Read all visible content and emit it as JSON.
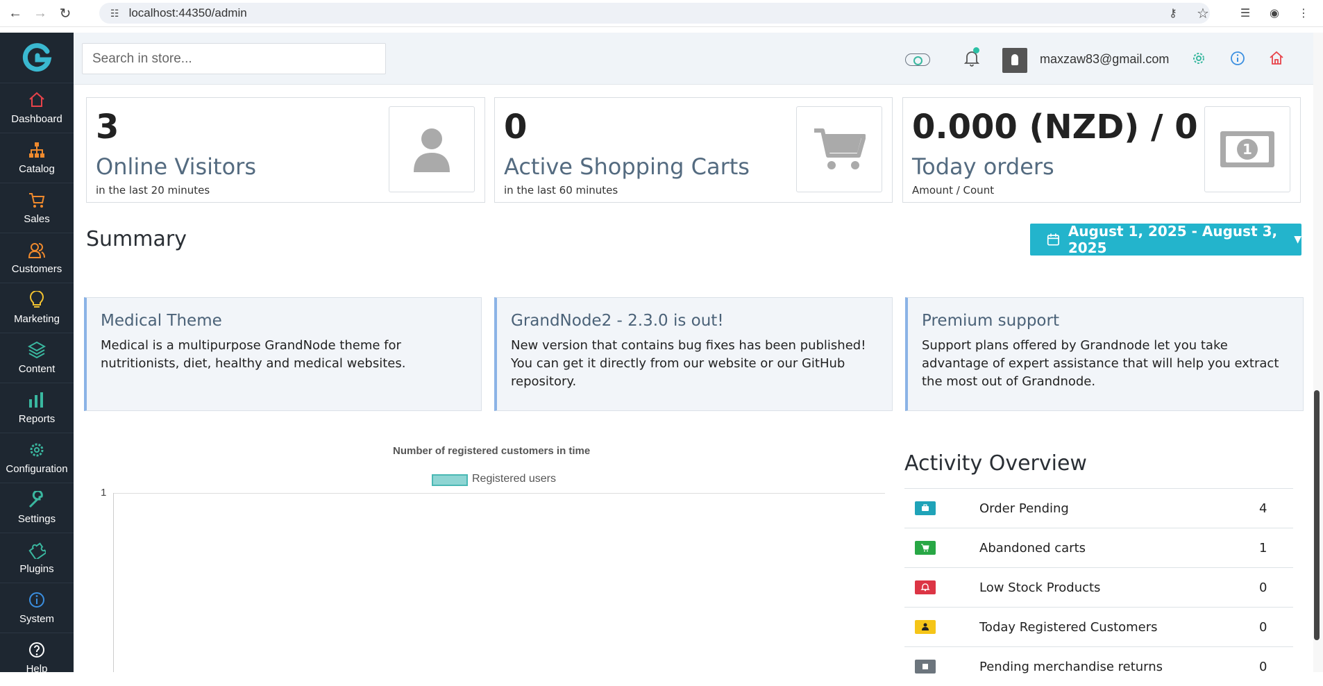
{
  "browser": {
    "url": "localhost:44350/admin"
  },
  "sidebar": {
    "items": [
      {
        "label": "Dashboard",
        "icon": "home-icon",
        "color": "#e8434a"
      },
      {
        "label": "Catalog",
        "icon": "sitemap-icon",
        "color": "#f08a2d"
      },
      {
        "label": "Sales",
        "icon": "cart-icon",
        "color": "#f08a2d"
      },
      {
        "label": "Customers",
        "icon": "users-icon",
        "color": "#f08a2d"
      },
      {
        "label": "Marketing",
        "icon": "bulb-icon",
        "color": "#f2c230"
      },
      {
        "label": "Content",
        "icon": "layers-icon",
        "color": "#3ab8a0"
      },
      {
        "label": "Reports",
        "icon": "bar-chart-icon",
        "color": "#3ab8a0"
      },
      {
        "label": "Configuration",
        "icon": "gear-icon",
        "color": "#3ab8a0"
      },
      {
        "label": "Settings",
        "icon": "wrench-icon",
        "color": "#3ab8a0"
      },
      {
        "label": "Plugins",
        "icon": "puzzle-icon",
        "color": "#3ab8a0"
      },
      {
        "label": "System",
        "icon": "info-icon",
        "color": "#3b8fe0"
      },
      {
        "label": "Help",
        "icon": "question-icon",
        "color": "#ffffff"
      }
    ]
  },
  "header": {
    "search_placeholder": "Search in store...",
    "user_email": "maxzaw83@gmail.com"
  },
  "stats": [
    {
      "value": "3",
      "title": "Online Visitors",
      "sub": "in the last 20 minutes",
      "icon": "user-icon"
    },
    {
      "value": "0",
      "title": "Active Shopping Carts",
      "sub": "in the last 60 minutes",
      "icon": "cart-icon"
    },
    {
      "value": "0.000 (NZD) / 0",
      "title": "Today orders",
      "sub": "Amount / Count",
      "icon": "money-icon"
    }
  ],
  "summary": {
    "title": "Summary",
    "date_range": "August 1, 2025 - August 3, 2025"
  },
  "news": [
    {
      "title": "Medical Theme",
      "body": "Medical is a multipurpose GrandNode theme for nutritionists, diet, healthy and medical websites."
    },
    {
      "title": "GrandNode2 - 2.3.0 is out!",
      "body": "New version that contains bug fixes has been published! You can get it directly from our website or our GitHub repository."
    },
    {
      "title": "Premium support",
      "body": "Support plans offered by Grandnode let you take advantage of expert assistance that will help you extract the most out of Grandnode."
    }
  ],
  "chart_data": {
    "type": "bar",
    "title": "Number of registered customers in time",
    "series": [
      {
        "name": "Registered users",
        "values": []
      }
    ],
    "y_ticks": [
      "1"
    ],
    "ylim": [
      0,
      1
    ],
    "color": "#8ed5d3"
  },
  "activity": {
    "title": "Activity Overview",
    "rows": [
      {
        "label": "Order Pending",
        "count": "4",
        "color": "#1fa3b8",
        "icon": "briefcase-icon"
      },
      {
        "label": "Abandoned carts",
        "count": "1",
        "color": "#28a745",
        "icon": "cart-icon"
      },
      {
        "label": "Low Stock Products",
        "count": "0",
        "color": "#dc3545",
        "icon": "bell-icon"
      },
      {
        "label": "Today Registered Customers",
        "count": "0",
        "color": "#f5c518",
        "icon": "user-icon"
      },
      {
        "label": "Pending merchandise returns",
        "count": "0",
        "color": "#6c757d",
        "icon": "return-icon"
      }
    ]
  }
}
